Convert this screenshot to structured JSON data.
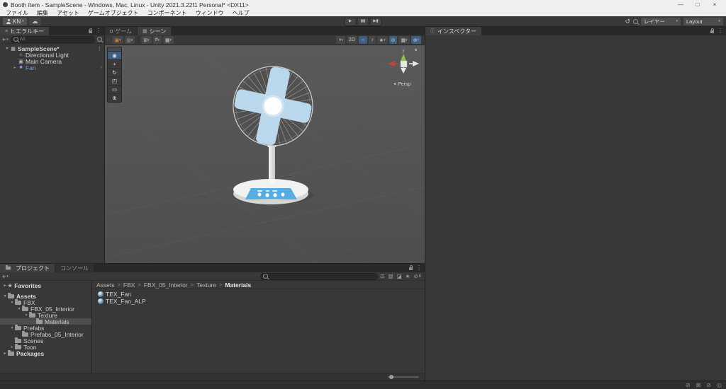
{
  "window": {
    "title": "Booth Item - SampleScene - Windows, Mac, Linux - Unity 2021.3.22f1 Personal* <DX11>",
    "minimize": "—",
    "maximize": "□",
    "close": "×"
  },
  "menubar": {
    "items": [
      "ファイル",
      "編集",
      "アセット",
      "ゲームオブジェクト",
      "コンポーネント",
      "ウィンドウ",
      "ヘルプ"
    ]
  },
  "toolbar": {
    "account_label": "KN",
    "cloud_icon": "☁",
    "play_icon": "▶",
    "pause_icon": "▮▮",
    "step_icon": "▶▮",
    "undo_history_icon": "↺",
    "layers_label": "レイヤー",
    "layout_label": "Layout"
  },
  "hierarchy": {
    "tab_label": "ヒエラルキー",
    "tab_icon": "≡",
    "search_placeholder": "All",
    "items": [
      {
        "label": "SampleScene*",
        "depth": 0,
        "icon": "scene-icon",
        "glyph": "▦",
        "bold": true,
        "arrow": "▼",
        "trailing": "⋮"
      },
      {
        "label": "Directional Light",
        "depth": 1,
        "icon": "light-icon",
        "glyph": "☼"
      },
      {
        "label": "Main Camera",
        "depth": 1,
        "icon": "camera-icon",
        "glyph": "▣"
      },
      {
        "label": "Fan",
        "depth": 1,
        "icon": "prefab-icon",
        "glyph": "■",
        "color": "#6ea0dc",
        "arrow": "▸",
        "trailing": "›"
      }
    ]
  },
  "scene": {
    "tabs": [
      {
        "label": "ゲーム",
        "name": "tab-game",
        "icon": "game-icon",
        "glyph": "◘",
        "active": false
      },
      {
        "label": "シーン",
        "name": "tab-scene",
        "icon": "scene-icon",
        "glyph": "▦",
        "active": true
      }
    ],
    "toolbar_left": [
      {
        "name": "tool-settings-button",
        "glyph": "▣",
        "caret": true,
        "color": "#c98239"
      },
      {
        "name": "pivot-orientation-button",
        "glyph": "◎",
        "caret": true
      },
      {
        "sep": true
      },
      {
        "name": "grid-snapping-button",
        "glyph": "⊞",
        "caret": true
      },
      {
        "name": "increment-snap-button",
        "glyph": "#",
        "caret": true
      },
      {
        "name": "snap-settings-button",
        "glyph": "▦",
        "caret": true
      }
    ],
    "toolbar_right": [
      {
        "name": "draw-mode-button",
        "glyph": "◑",
        "caret": true
      },
      {
        "name": "2d-toggle",
        "label": "2D"
      },
      {
        "name": "lighting-toggle",
        "glyph": "☼",
        "active": true
      },
      {
        "name": "audio-toggle",
        "glyph": "♪"
      },
      {
        "name": "effects-button",
        "glyph": "★",
        "caret": true
      },
      {
        "name": "scene-visibility-toggle",
        "glyph": "⊘",
        "active": true
      },
      {
        "name": "grid-visibility-button",
        "glyph": "▦",
        "caret": true
      },
      {
        "name": "gizmos-toggle",
        "glyph": "⊕",
        "caret": true,
        "active": true
      }
    ],
    "tools_overlay": [
      {
        "name": "view-tool",
        "glyph": "◉",
        "active": true
      },
      {
        "name": "move-tool",
        "glyph": "+"
      },
      {
        "name": "rotate-tool",
        "glyph": "↻"
      },
      {
        "name": "scale-tool",
        "glyph": "◰"
      },
      {
        "name": "rect-tool",
        "glyph": "▭"
      },
      {
        "name": "transform-tool",
        "glyph": "⊕"
      }
    ],
    "gizmo": {
      "x_label": "x",
      "y_label": "y",
      "persp_icon": "◄",
      "persp_label": "Persp"
    }
  },
  "inspector": {
    "tab_label": "インスペクター",
    "tab_icon": "ⓘ"
  },
  "project": {
    "tabs": [
      {
        "label": "プロジェクト",
        "name": "tab-project",
        "active": true
      },
      {
        "label": "コンソール",
        "name": "tab-console",
        "active": false
      }
    ],
    "search_controls": [
      {
        "name": "search-by-type-icon",
        "glyph": "⊡"
      },
      {
        "name": "search-by-package-icon",
        "glyph": "▧"
      },
      {
        "name": "search-by-label-icon",
        "glyph": "◪"
      },
      {
        "name": "save-search-icon",
        "glyph": "★"
      },
      {
        "name": "hidden-packages-icon",
        "glyph": "⊘",
        "count": "6"
      }
    ],
    "breadcrumb": [
      "Assets",
      "FBX",
      "FBX_05_Interior",
      "Texture",
      "Materials"
    ],
    "tree": [
      {
        "label": "Favorites",
        "depth": 0,
        "icon": "star",
        "bold": true,
        "arrow": "▸",
        "gap_after": true
      },
      {
        "label": "Assets",
        "depth": 0,
        "icon": "folder",
        "bold": true,
        "arrow": "▾"
      },
      {
        "label": "FBX",
        "depth": 1,
        "icon": "folder",
        "arrow": "▾"
      },
      {
        "label": "FBX_05_Interior",
        "depth": 2,
        "icon": "folder",
        "arrow": "▾"
      },
      {
        "label": "Texture",
        "depth": 3,
        "icon": "folder",
        "arrow": "▾"
      },
      {
        "label": "Materials",
        "depth": 4,
        "icon": "folder",
        "selected": true
      },
      {
        "label": "Prefabs",
        "depth": 1,
        "icon": "folder",
        "arrow": "▾"
      },
      {
        "label": "Prefabs_05_Interior",
        "depth": 2,
        "icon": "folder"
      },
      {
        "label": "Scenes",
        "depth": 1,
        "icon": "folder"
      },
      {
        "label": "Toon",
        "depth": 1,
        "icon": "folder",
        "arrow": "▸"
      },
      {
        "label": "Packages",
        "depth": 0,
        "icon": "folder",
        "bold": true,
        "arrow": "▸"
      }
    ],
    "files": [
      {
        "name": "TEX_Fan"
      },
      {
        "name": "TEX_Fan_ALP"
      }
    ]
  },
  "statusbar": {
    "icons": [
      {
        "name": "console-message-icon",
        "glyph": "⊘"
      },
      {
        "name": "console-warning-icon",
        "glyph": "⊠"
      },
      {
        "name": "console-error-icon",
        "glyph": "⊘"
      },
      {
        "name": "background-tasks-icon",
        "glyph": "◎"
      }
    ]
  },
  "colors": {
    "accent_active": "#3e5f80",
    "selection": "#4d4d4d",
    "prefab_text": "#6ea0dc",
    "fan_blade": "#bcdef4",
    "fan_sticker": "#55ade1",
    "viewport_bg": "#565656"
  }
}
